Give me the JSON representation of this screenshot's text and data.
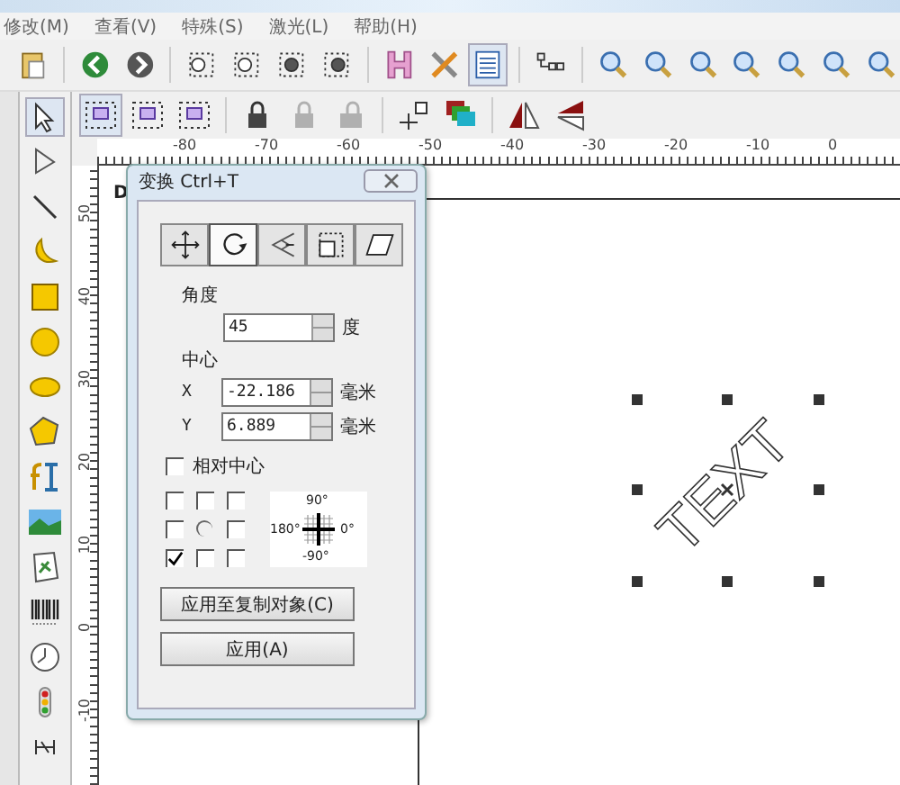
{
  "menu": [
    {
      "label": "修改(M)"
    },
    {
      "label": "查看(V)"
    },
    {
      "label": "特殊(S)"
    },
    {
      "label": "激光(L)"
    },
    {
      "label": "帮助(H)"
    }
  ],
  "ruler_h": [
    "-80",
    "-70",
    "-60",
    "-50",
    "-40",
    "-30",
    "-20",
    "-10",
    "0"
  ],
  "ruler_v": [
    "50",
    "40",
    "30",
    "20",
    "10",
    "0",
    "-10"
  ],
  "canvas": {
    "corner_text": "D",
    "object_text": "TEXT"
  },
  "dialog": {
    "title": "变换 Ctrl+T",
    "tabs": [
      {
        "kind": "move",
        "selected": false
      },
      {
        "kind": "rotate",
        "selected": true
      },
      {
        "kind": "scale",
        "selected": false
      },
      {
        "kind": "size",
        "selected": false
      },
      {
        "kind": "skew",
        "selected": false
      }
    ],
    "angle_label": "角度",
    "angle": "45",
    "angle_unit": "度",
    "center_label": "中心",
    "fields": [
      {
        "label": "X",
        "value": "-22.186",
        "unit": "毫米"
      },
      {
        "label": "Y",
        "value": "6.889",
        "unit": "毫米"
      }
    ],
    "relative_center": {
      "label": "相对中心",
      "checked": false
    },
    "anchors": [
      {
        "kind": "box",
        "checked": false
      },
      {
        "kind": "box",
        "checked": false
      },
      {
        "kind": "box",
        "checked": false
      },
      {
        "kind": "box",
        "checked": false
      },
      {
        "kind": "radio",
        "checked": false
      },
      {
        "kind": "box",
        "checked": false
      },
      {
        "kind": "box",
        "checked": true
      },
      {
        "kind": "box",
        "checked": false
      },
      {
        "kind": "box",
        "checked": false
      }
    ],
    "compass": {
      "top": "90°",
      "left": "180°",
      "right": "0°",
      "bottom": "-90°"
    },
    "buttons": [
      "应用至复制对象(C)",
      "应用(A)"
    ]
  }
}
